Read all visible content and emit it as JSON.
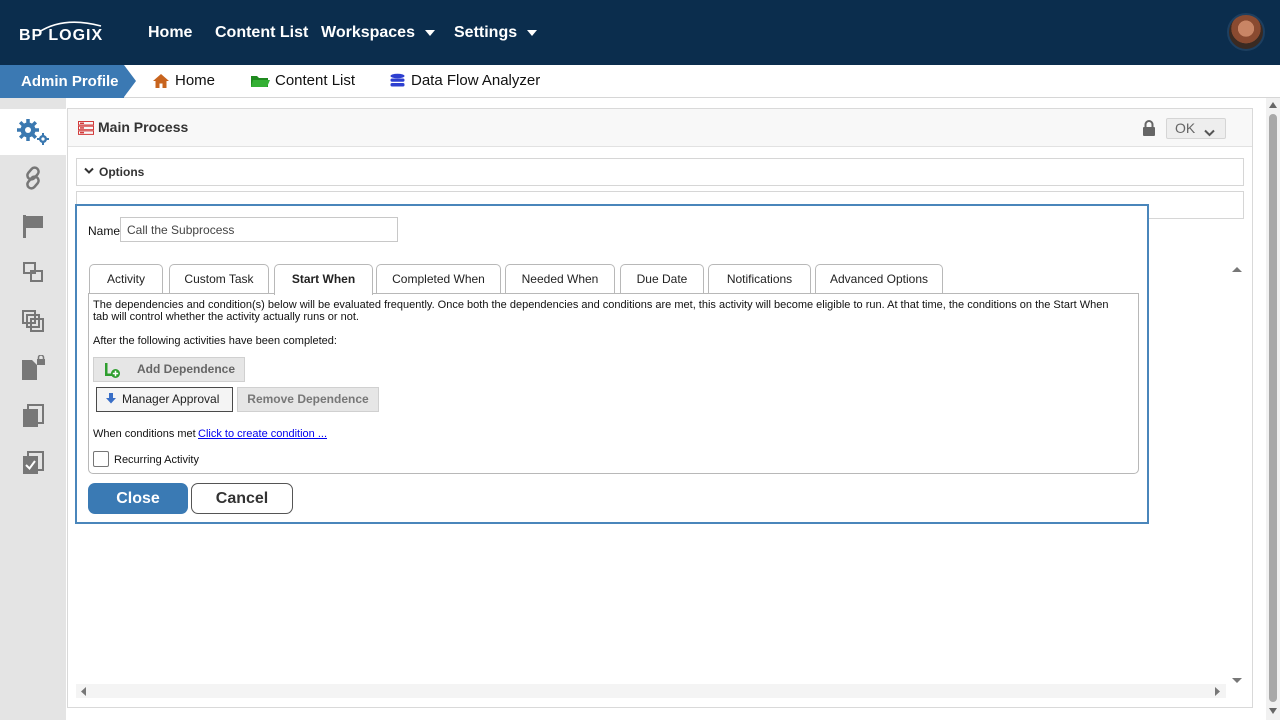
{
  "topbar": {
    "logo": "BP LOGIX",
    "nav": [
      {
        "label": "Home"
      },
      {
        "label": "Content List"
      },
      {
        "label": "Workspaces",
        "has_dropdown": true
      },
      {
        "label": "Settings",
        "has_dropdown": true
      }
    ],
    "avatar": "user-avatar"
  },
  "breadcrumb": {
    "admin_label": "Admin Profile",
    "items": [
      {
        "label": "Home",
        "icon": "home-icon",
        "color": "#c8641e"
      },
      {
        "label": "Content List",
        "icon": "folder-icon",
        "color": "#2e9e2e"
      },
      {
        "label": "Data Flow Analyzer",
        "icon": "database-icon",
        "color": "#2d3fd0"
      }
    ]
  },
  "sidebar": {
    "items": [
      {
        "icon": "gears-icon",
        "active": true
      },
      {
        "icon": "link-icon"
      },
      {
        "icon": "flag-icon"
      },
      {
        "icon": "subprocess-icon"
      },
      {
        "icon": "copy-layers-icon"
      },
      {
        "icon": "locked-document-icon"
      },
      {
        "icon": "documents-icon"
      },
      {
        "icon": "checklist-icon"
      }
    ]
  },
  "main": {
    "title": "Main Process",
    "ok_label": "OK",
    "options_label": "Options"
  },
  "dialog": {
    "name_label": "Name",
    "name_value": "Call the Subprocess",
    "tabs": [
      {
        "label": "Activity"
      },
      {
        "label": "Custom Task"
      },
      {
        "label": "Start When",
        "active": true
      },
      {
        "label": "Completed When"
      },
      {
        "label": "Needed When"
      },
      {
        "label": "Due Date"
      },
      {
        "label": "Notifications"
      },
      {
        "label": "Advanced Options"
      }
    ],
    "description": "The dependencies and condition(s) below will be evaluated frequently. Once both the dependencies and conditions are met, this activity will become eligible to run. At that time, the conditions on the Start When tab will control whether the activity actually runs or not.",
    "after_label": "After the following activities have been completed:",
    "add_dependence": "Add Dependence",
    "dependency_item": "Manager Approval",
    "remove_dependence": "Remove Dependence",
    "conditions_label": "When conditions met",
    "conditions_link": "Click to create condition ...",
    "recurring_label": "Recurring Activity",
    "close_label": "Close",
    "cancel_label": "Cancel"
  },
  "colors": {
    "topbar_bg": "#0b2d4d",
    "accent": "#3b79b3",
    "link": "#0000ee"
  }
}
